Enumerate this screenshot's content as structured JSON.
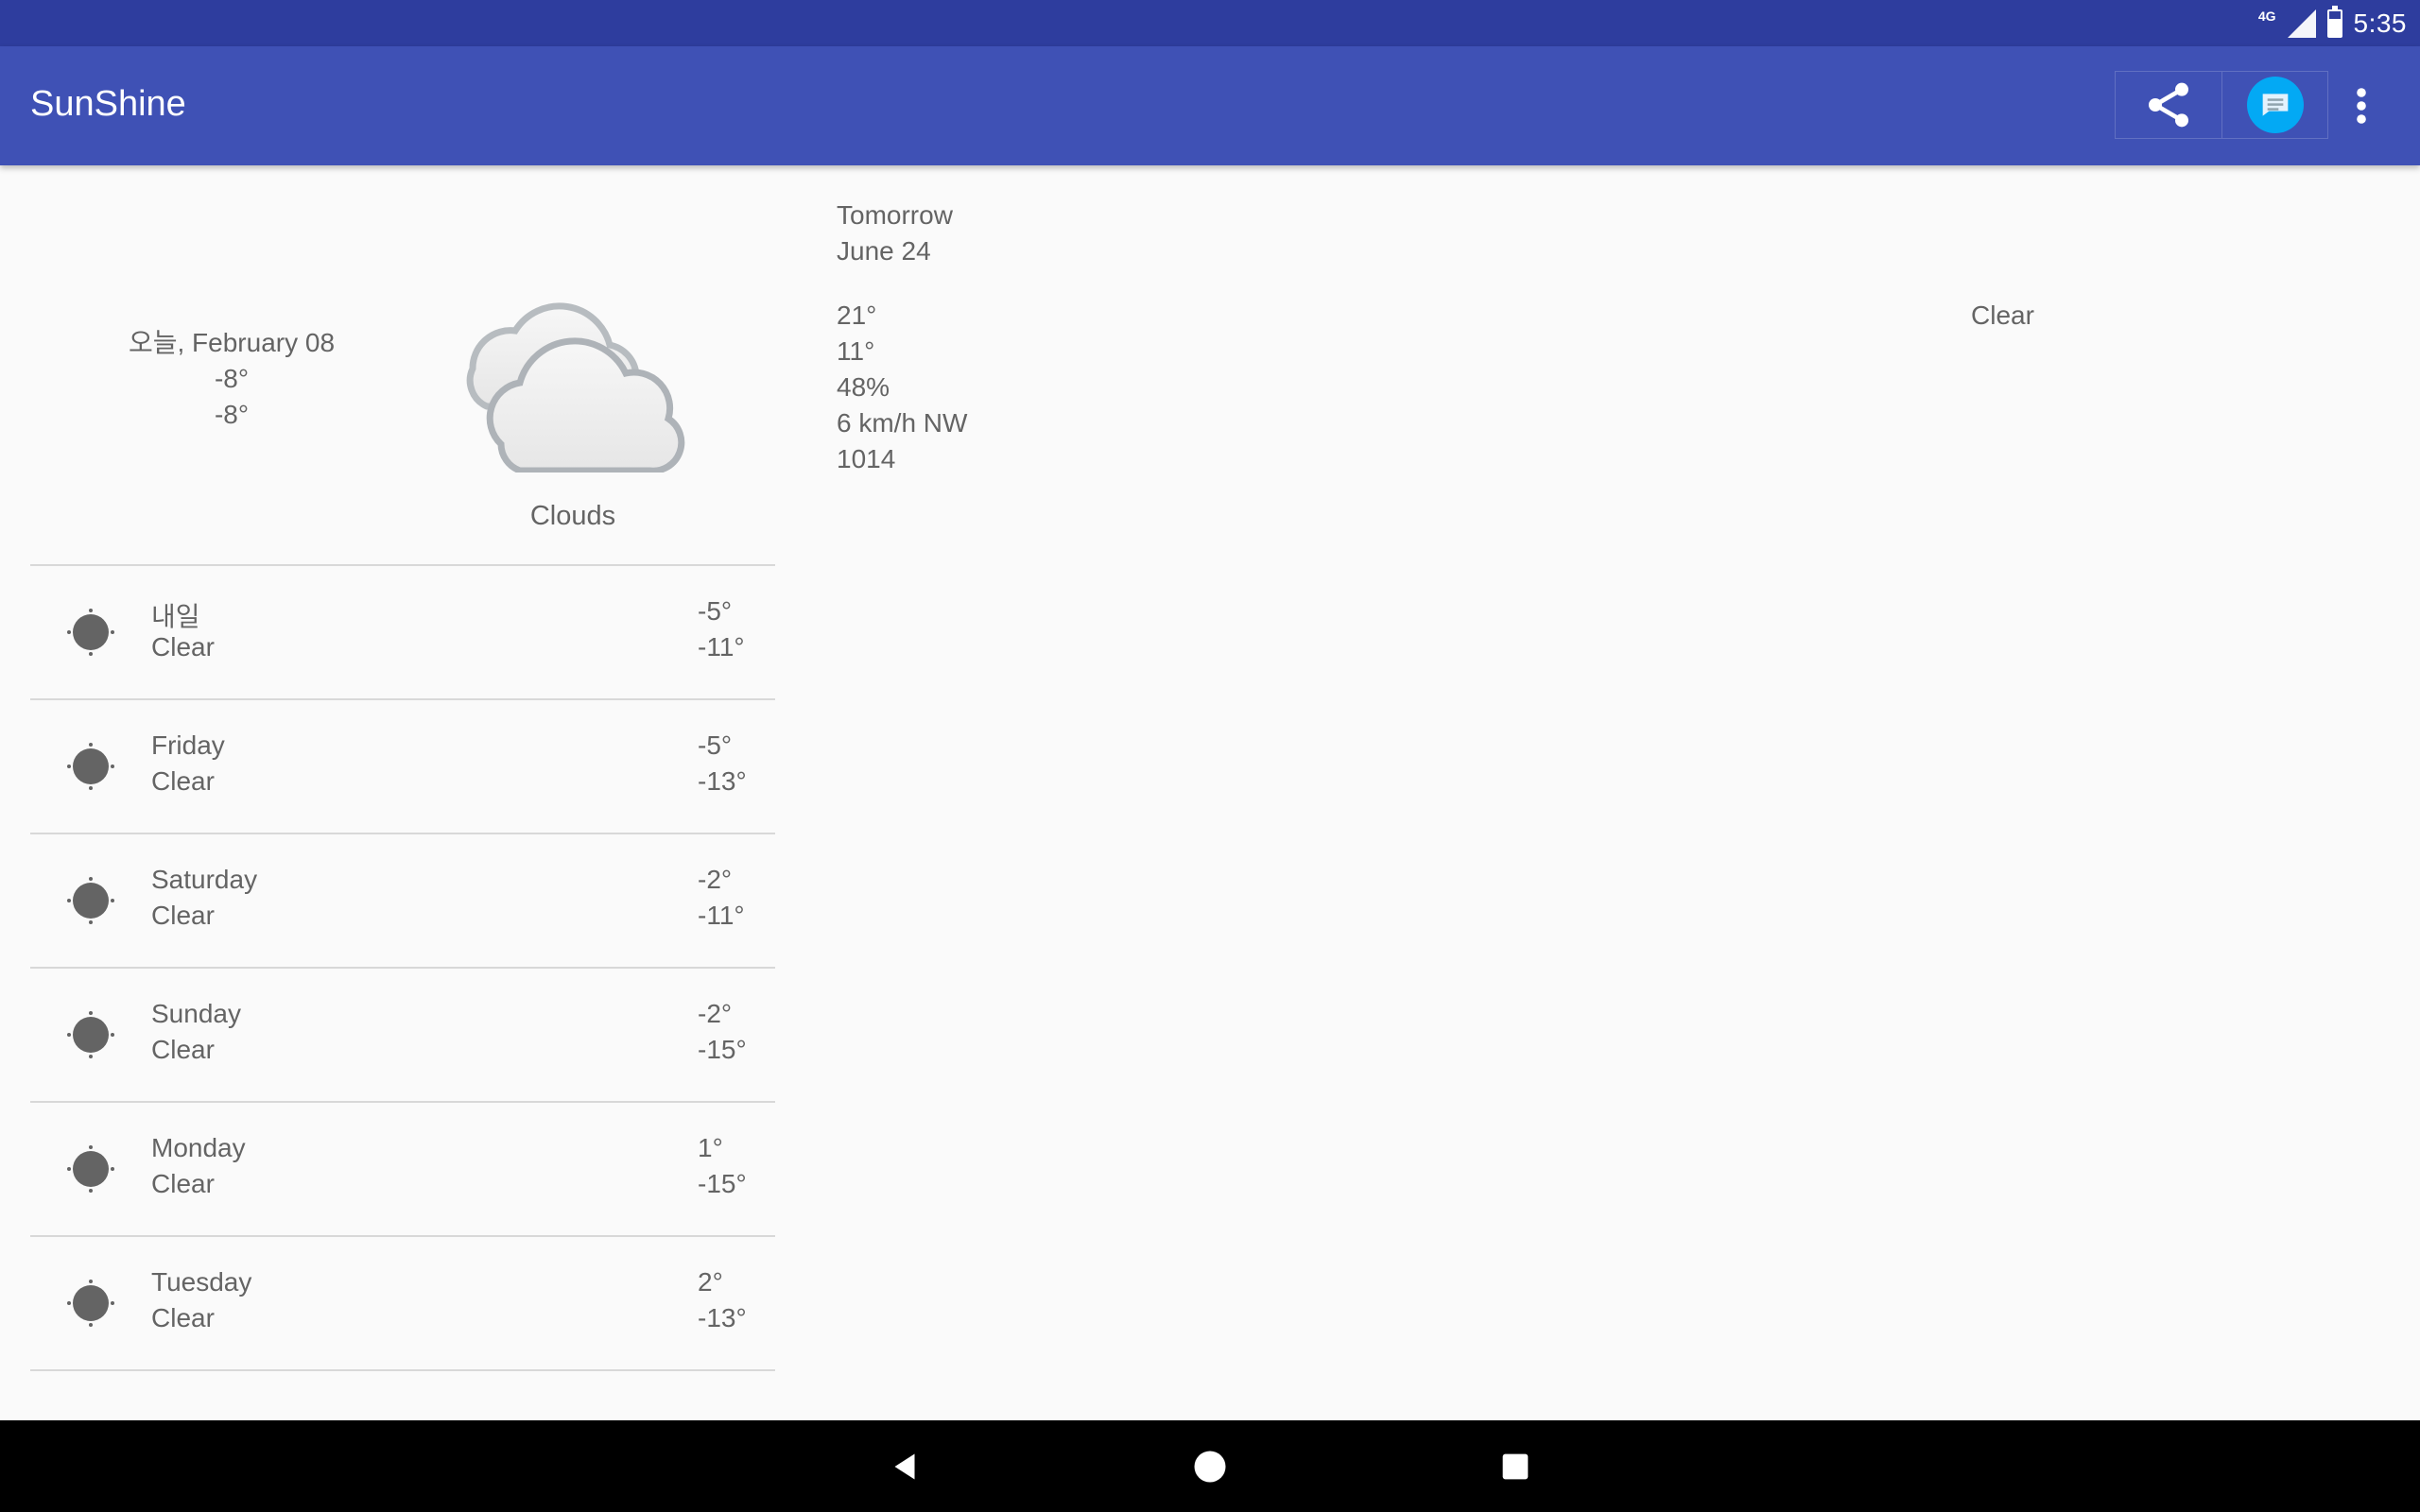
{
  "status_bar": {
    "network": "4G",
    "time": "5:35"
  },
  "app_bar": {
    "title": "SunShine",
    "actions": [
      "share-icon",
      "message-icon",
      "more-vert-icon"
    ]
  },
  "today": {
    "date": "오늘, February 08",
    "high": "-8°",
    "low": "-8°",
    "condition": "Clouds",
    "icon": "clouds-icon"
  },
  "forecast": [
    {
      "day": "내일",
      "condition": "Clear",
      "high": "-5°",
      "low": "-11°"
    },
    {
      "day": "Friday",
      "condition": "Clear",
      "high": "-5°",
      "low": "-13°"
    },
    {
      "day": "Saturday",
      "condition": "Clear",
      "high": "-2°",
      "low": "-11°"
    },
    {
      "day": "Sunday",
      "condition": "Clear",
      "high": "-2°",
      "low": "-15°"
    },
    {
      "day": "Monday",
      "condition": "Clear",
      "high": "1°",
      "low": "-15°"
    },
    {
      "day": "Tuesday",
      "condition": "Clear",
      "high": "2°",
      "low": "-13°"
    }
  ],
  "detail": {
    "day": "Tomorrow",
    "date": "June 24",
    "high": "21°",
    "low": "11°",
    "humidity": "48%",
    "wind": "6 km/h NW",
    "pressure": "1014",
    "condition": "Clear"
  },
  "colors": {
    "status_bar": "#2e3d9e",
    "app_bar": "#3f51b5",
    "accent": "#03a9f4",
    "text": "#646464"
  }
}
